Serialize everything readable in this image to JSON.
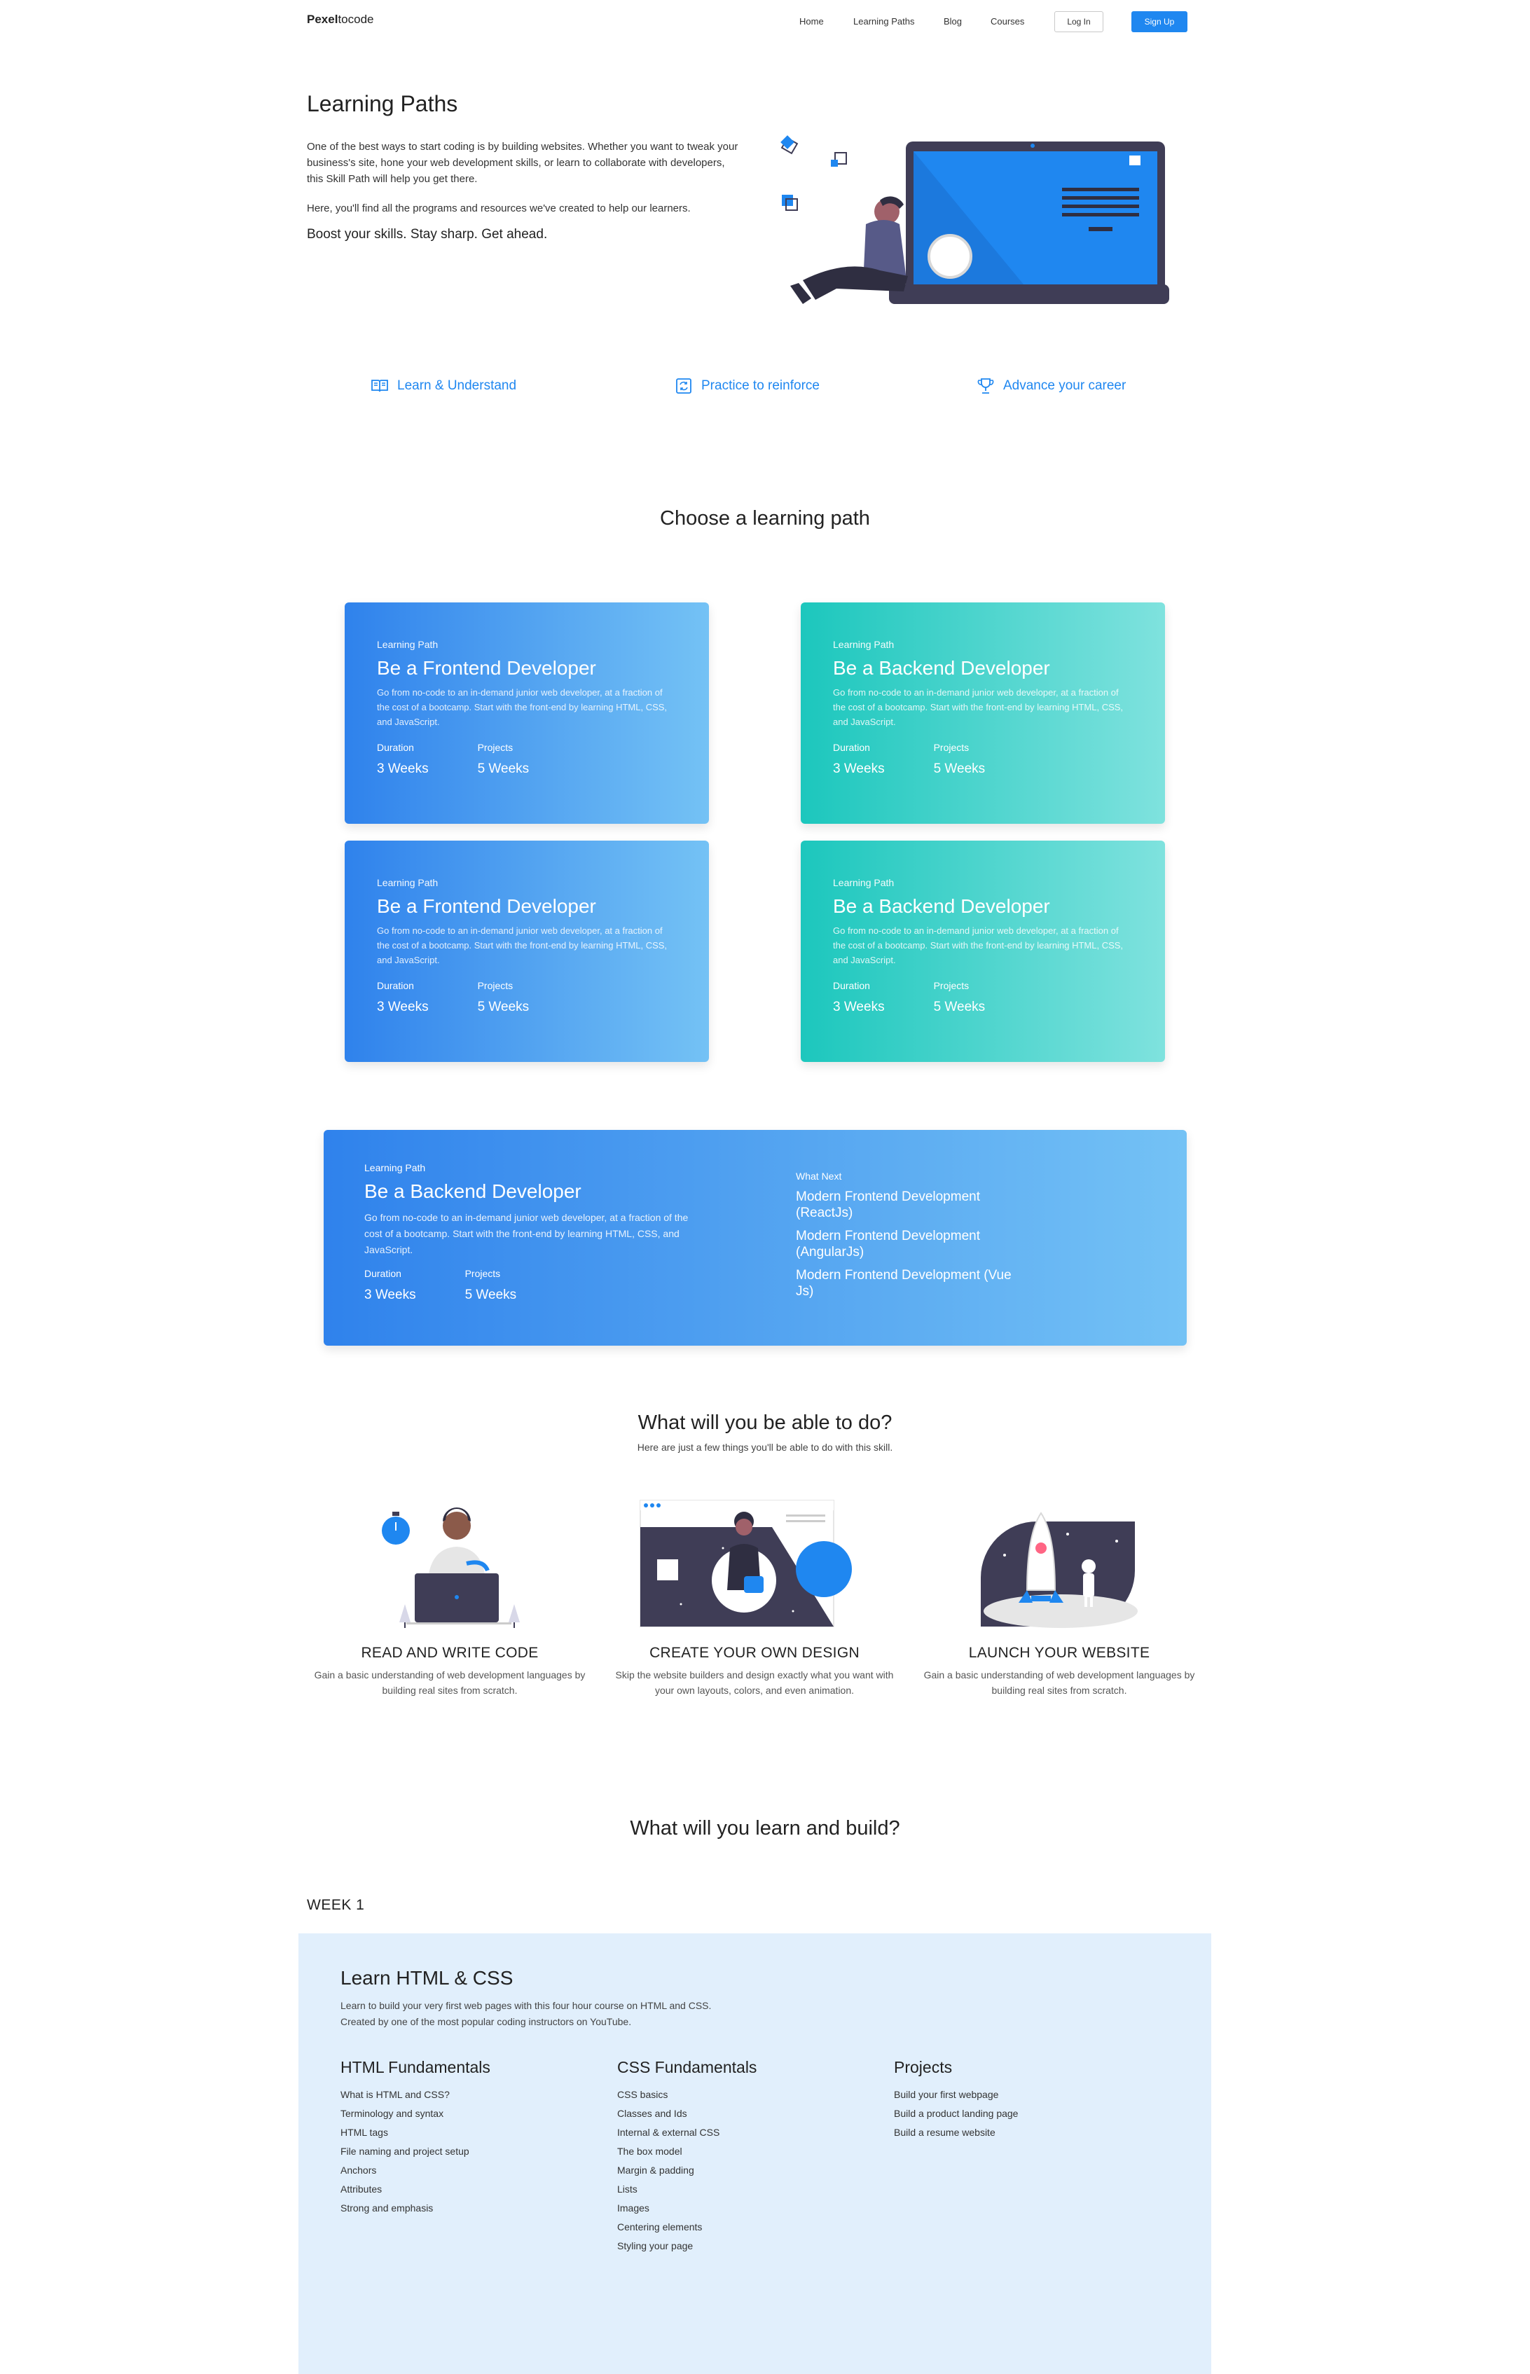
{
  "nav": {
    "brand_bold": "Pexel",
    "brand_rest": "tocode",
    "links": [
      "Home",
      "Learning Paths",
      "Blog",
      "Courses"
    ],
    "login": "Log In",
    "signup": "Sign Up"
  },
  "hero": {
    "title": "Learning Paths",
    "p1": "One of the best ways to start coding is by building websites. Whether you want to tweak your business's site, hone your web development skills, or learn to collaborate with developers, this Skill Path will help you get there.",
    "p2": "Here, you'll find all the programs and resources we've created to help our learners.",
    "strong": "Boost your skills. Stay sharp. Get ahead."
  },
  "features": [
    {
      "label": "Learn & Understand",
      "icon": "book-icon"
    },
    {
      "label": "Practice to reinforce",
      "icon": "practice-icon"
    },
    {
      "label": "Advance your career",
      "icon": "trophy-icon"
    }
  ],
  "paths": {
    "title": "Choose a learning path",
    "cards": [
      {
        "label": "Learning Path",
        "title": "Be a Frontend Developer",
        "desc": "Go from no-code to an in-demand junior web developer, at a fraction of the cost of a bootcamp. Start with the front-end by learning HTML, CSS, and JavaScript.",
        "duration_label": "Duration",
        "duration": "3 Weeks",
        "projects_label": "Projects",
        "projects": "5 Weeks"
      },
      {
        "label": "Learning Path",
        "title": "Be a Backend Developer",
        "desc": "Go from no-code to an in-demand junior web developer, at a fraction of the cost of a bootcamp. Start with the front-end by learning HTML, CSS, and JavaScript.",
        "duration_label": "Duration",
        "duration": "3 Weeks",
        "projects_label": "Projects",
        "projects": "5 Weeks"
      },
      {
        "label": "Learning Path",
        "title": "Be a Frontend Developer",
        "desc": "Go from no-code to an in-demand junior web developer, at a fraction of the cost of a bootcamp. Start with the front-end by learning HTML, CSS, and JavaScript.",
        "duration_label": "Duration",
        "duration": "3 Weeks",
        "projects_label": "Projects",
        "projects": "5 Weeks"
      },
      {
        "label": "Learning Path",
        "title": "Be a Backend Developer",
        "desc": "Go from no-code to an in-demand junior web developer, at a fraction of the cost of a bootcamp. Start with the front-end by learning HTML, CSS, and JavaScript.",
        "duration_label": "Duration",
        "duration": "3 Weeks",
        "projects_label": "Projects",
        "projects": "5 Weeks"
      }
    ],
    "wide": {
      "label": "Learning Path",
      "title": "Be a Backend Developer",
      "desc": "Go from no-code to an in-demand junior web developer, at a fraction of the cost of a bootcamp. Start with the front-end by learning HTML, CSS, and JavaScript.",
      "duration_label": "Duration",
      "duration": "3 Weeks",
      "projects_label": "Projects",
      "projects": "5 Weeks",
      "next_head": "What Next",
      "next": [
        "Modern Frontend Development (ReactJs)",
        "Modern Frontend Development (AngularJs)",
        "Modern Frontend Development (Vue Js)"
      ]
    }
  },
  "abilities": {
    "title": "What will you be able to do?",
    "subtitle": "Here are just a few things you'll be able to do with this skill.",
    "items": [
      {
        "title": "READ AND WRITE CODE",
        "desc": "Gain a basic understanding of web development languages by building real sites from scratch."
      },
      {
        "title": "CREATE YOUR OWN DESIGN",
        "desc": "Skip the website builders and design exactly what you want with your own layouts, colors, and even animation."
      },
      {
        "title": "LAUNCH YOUR WEBSITE",
        "desc": "Gain a basic understanding of web development languages by building real sites from scratch."
      }
    ]
  },
  "learn": {
    "title": "What will you learn and build?",
    "week": "WEEK 1",
    "course_title": "Learn HTML & CSS",
    "course_desc": "Learn to build your very first web pages with this four hour course on HTML and CSS. Created by one of the most popular coding instructors on YouTube.",
    "columns": [
      {
        "heading": "HTML Fundamentals",
        "items": [
          "What is HTML and CSS?",
          "Terminology and syntax",
          "HTML tags",
          "File naming and project setup",
          "Anchors",
          "Attributes",
          "Strong and emphasis"
        ]
      },
      {
        "heading": "CSS Fundamentals",
        "items": [
          "CSS basics",
          "Classes and Ids",
          "Internal & external CSS",
          "The box model",
          "Margin & padding",
          "Lists",
          "Images",
          "Centering elements",
          "Styling your page"
        ]
      },
      {
        "heading": "Projects",
        "items": [
          "Build your first webpage",
          "Build a product landing page",
          "Build a resume website"
        ]
      }
    ]
  },
  "colors": {
    "accent": "#1f87f0",
    "blue_start": "#2f82ec",
    "blue_end": "#74c2f5",
    "teal_start": "#1cc7bd",
    "teal_end": "#7fe2de",
    "panel": "#e1effc"
  }
}
